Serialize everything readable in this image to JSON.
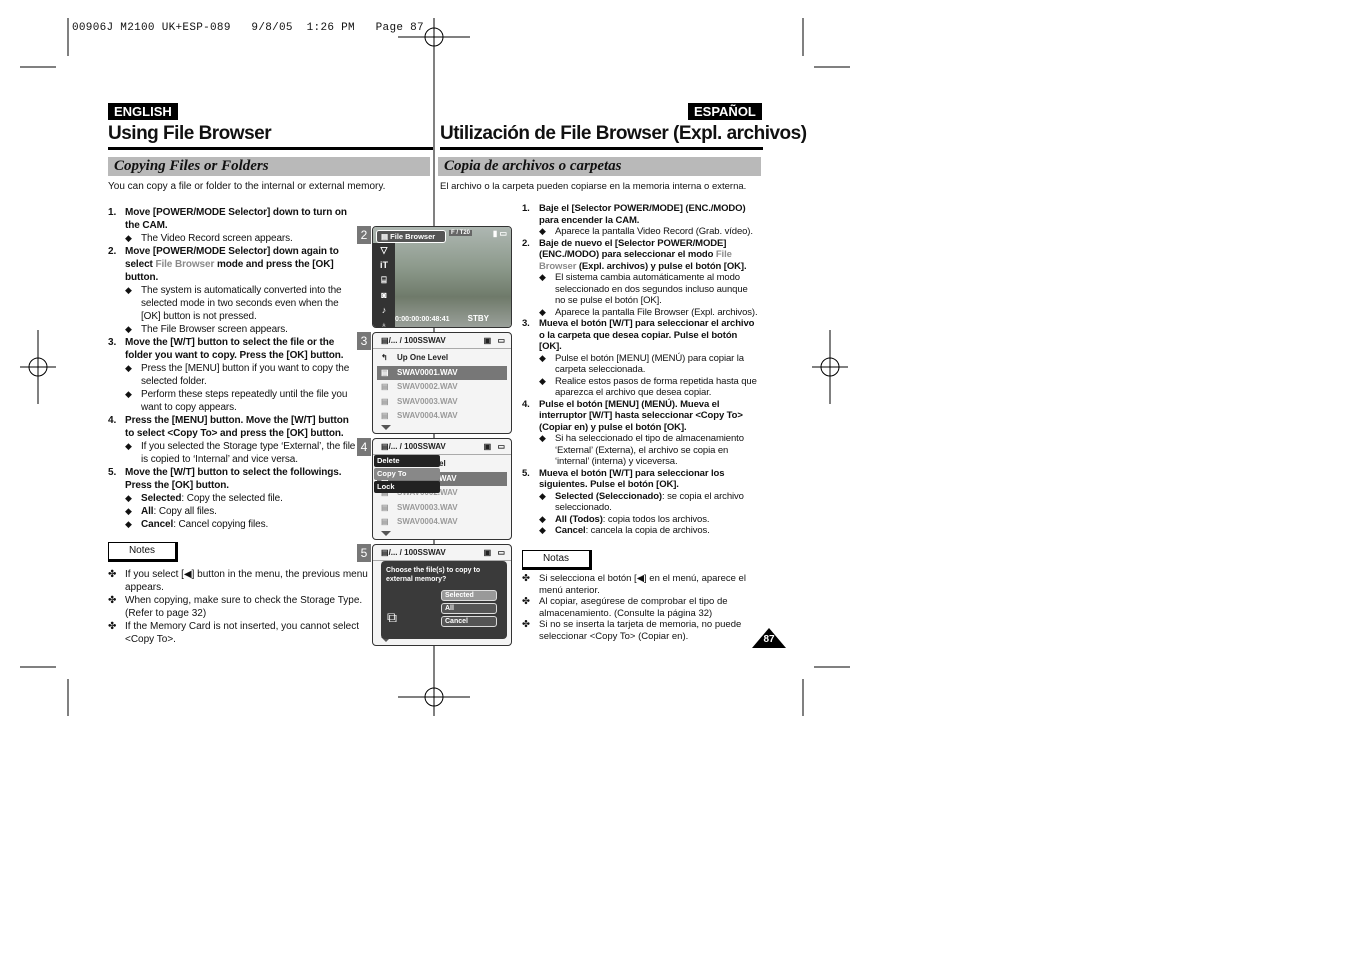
{
  "slug": "00906J M2100 UK+ESP-089   9/8/05  1:26 PM   Page 87",
  "page_number": "87",
  "en": {
    "badge": "ENGLISH",
    "title": "Using File Browser",
    "section": "Copying Files or Folders",
    "intro": "You can copy a file or folder to the internal or external memory.",
    "steps": [
      {
        "num": "1.",
        "pre": "Move [POWER/MODE Selector] down to turn on the CAM.",
        "hl": "",
        "post": "",
        "bullets": [
          "The Video Record screen appears."
        ]
      },
      {
        "num": "2.",
        "pre": "Move [POWER/MODE Selector] down again to select ",
        "hl": "File Browser",
        "post": " mode and press the [OK] button.",
        "bullets": [
          "The system is automatically converted into the selected mode in two seconds even when the [OK] button is not pressed.",
          "The File Browser screen appears."
        ]
      },
      {
        "num": "3.",
        "pre": "Move the [W/T] button to select the file or the folder you want to copy. Press the [OK] button.",
        "hl": "",
        "post": "",
        "bullets": [
          "Press the [MENU] button if you want to copy the selected folder.",
          "Perform these steps repeatedly until the file you want to copy appears."
        ]
      },
      {
        "num": "4.",
        "pre": "Press the [MENU] button. Move the [W/T] button to select <Copy To> and press the [OK] button.",
        "hl": "",
        "post": "",
        "bullets": [
          "If you selected the Storage type ‘External’, the file is copied to ‘Internal’ and vice versa."
        ]
      },
      {
        "num": "5.",
        "pre": "Move the [W/T] button to select the followings. Press the [OK] button.",
        "hl": "",
        "post": "",
        "bullets_rich": [
          {
            "b": "Selected",
            "t": ": Copy the selected file."
          },
          {
            "b": "All",
            "t": ": Copy all files."
          },
          {
            "b": "Cancel",
            "t": ": Cancel copying files."
          }
        ]
      }
    ],
    "notes_label": "Notes",
    "notes": [
      "If you select [◀] button in the menu, the previous menu appears.",
      "When copying, make sure to check the Storage Type. (Refer to page 32)",
      "If the Memory Card is not inserted, you cannot select <Copy To>."
    ]
  },
  "es": {
    "badge": "ESPAÑOL",
    "title": "Utilización de File Browser (Expl. archivos)",
    "section": "Copia de archivos o carpetas",
    "intro": "El archivo o la carpeta pueden copiarse en la memoria interna o externa.",
    "steps": [
      {
        "num": "1.",
        "pre": "Baje el [Selector POWER/MODE] (ENC./MODO) para encender la CAM.",
        "hl": "",
        "post": "",
        "bullets": [
          "Aparece la pantalla Video Record (Grab. vídeo)."
        ]
      },
      {
        "num": "2.",
        "pre": "Baje de nuevo el [Selector POWER/MODE] (ENC./MODO) para seleccionar el modo ",
        "hl": "File Browser",
        "post": " (Expl. archivos) y pulse el botón [OK].",
        "bullets": [
          "El sistema cambia automáticamente al modo seleccionado en dos segundos incluso aunque no se pulse el botón [OK].",
          "Aparece la pantalla File Browser (Expl. archivos)."
        ]
      },
      {
        "num": "3.",
        "pre": "Mueva el botón [W/T] para seleccionar el archivo o la carpeta que desea copiar. Pulse el botón [OK].",
        "hl": "",
        "post": "",
        "bullets": [
          "Pulse el botón [MENU] (MENÚ) para copiar la carpeta seleccionada.",
          "Realice estos pasos de forma repetida hasta que aparezca el archivo que desea copiar."
        ]
      },
      {
        "num": "4.",
        "pre": "Pulse el botón [MENU] (MENÚ). Mueva el interruptor [W/T] hasta seleccionar <Copy To> (Copiar en) y pulse el botón [OK].",
        "hl": "",
        "post": "",
        "bullets": [
          "Si ha seleccionado el tipo de almacenamiento ‘External’ (Externa), el archivo se copia en ‘internal’ (interna) y viceversa."
        ]
      },
      {
        "num": "5.",
        "pre": "Mueva el botón [W/T] para seleccionar los siguientes. Pulse el botón [OK].",
        "hl": "",
        "post": "",
        "bullets_rich": [
          {
            "b": "Selected (Seleccionado)",
            "t": ": se copia el archivo seleccionado."
          },
          {
            "b": "All (Todos)",
            "t": ": copia todos los archivos."
          },
          {
            "b": "Cancel",
            "t": ": cancela la copia de archivos."
          }
        ]
      }
    ],
    "notes_label": "Notas",
    "notes": [
      "Si selecciona el botón [◀] en el menú, aparece el menú anterior.",
      "Al copiar, asegúrese de comprobar el tipo de almacenamiento. (Consulte la página 32)",
      "Si no se inserta la tarjeta de memoria, no puede seleccionar <Copy To> (Copiar en)."
    ]
  },
  "screens": {
    "s2": {
      "num": "2",
      "tab": "File Browser",
      "counter": "F / T20",
      "timecode": "0:00:00:00:48:41",
      "status": "STBY"
    },
    "s3": {
      "num": "3",
      "path": "/... / 100SSWAV",
      "up": "Up One Level",
      "files": [
        "SWAV0001.WAV",
        "SWAV0002.WAV",
        "SWAV0003.WAV",
        "SWAV0004.WAV"
      ]
    },
    "s4": {
      "num": "4",
      "path": "/... / 100SSWAV",
      "menu": [
        "Delete",
        "Copy To",
        "Lock"
      ],
      "behind": "el",
      "sel_tail": "WAV",
      "files": [
        "SWAV0002.WAV",
        "SWAV0003.WAV",
        "SWAV0004.WAV"
      ]
    },
    "s5": {
      "num": "5",
      "path": "/... / 100SSWAV",
      "question": "Choose the file(s) to copy to external memory?",
      "options": [
        "Selected",
        "All",
        "Cancel"
      ]
    }
  }
}
